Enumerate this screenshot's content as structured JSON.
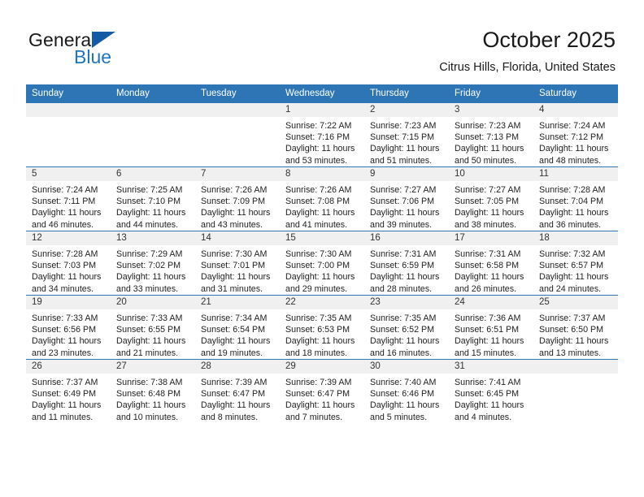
{
  "brand": {
    "name_part1": "General",
    "name_part2": "Blue",
    "accent_color": "#1e74c4",
    "triangle_color": "#1359a5"
  },
  "header": {
    "month_title": "October 2025",
    "location": "Citrus Hills, Florida, United States"
  },
  "calendar": {
    "header_color": "#2e75b6",
    "daynum_band_color": "#f0f0f0",
    "weekdays": [
      "Sunday",
      "Monday",
      "Tuesday",
      "Wednesday",
      "Thursday",
      "Friday",
      "Saturday"
    ],
    "weeks": [
      [
        {
          "day": "",
          "empty": true
        },
        {
          "day": "",
          "empty": true
        },
        {
          "day": "",
          "empty": true
        },
        {
          "day": "1",
          "sunrise": "Sunrise: 7:22 AM",
          "sunset": "Sunset: 7:16 PM",
          "daylight_l1": "Daylight: 11 hours",
          "daylight_l2": "and 53 minutes."
        },
        {
          "day": "2",
          "sunrise": "Sunrise: 7:23 AM",
          "sunset": "Sunset: 7:15 PM",
          "daylight_l1": "Daylight: 11 hours",
          "daylight_l2": "and 51 minutes."
        },
        {
          "day": "3",
          "sunrise": "Sunrise: 7:23 AM",
          "sunset": "Sunset: 7:13 PM",
          "daylight_l1": "Daylight: 11 hours",
          "daylight_l2": "and 50 minutes."
        },
        {
          "day": "4",
          "sunrise": "Sunrise: 7:24 AM",
          "sunset": "Sunset: 7:12 PM",
          "daylight_l1": "Daylight: 11 hours",
          "daylight_l2": "and 48 minutes."
        }
      ],
      [
        {
          "day": "5",
          "sunrise": "Sunrise: 7:24 AM",
          "sunset": "Sunset: 7:11 PM",
          "daylight_l1": "Daylight: 11 hours",
          "daylight_l2": "and 46 minutes."
        },
        {
          "day": "6",
          "sunrise": "Sunrise: 7:25 AM",
          "sunset": "Sunset: 7:10 PM",
          "daylight_l1": "Daylight: 11 hours",
          "daylight_l2": "and 44 minutes."
        },
        {
          "day": "7",
          "sunrise": "Sunrise: 7:26 AM",
          "sunset": "Sunset: 7:09 PM",
          "daylight_l1": "Daylight: 11 hours",
          "daylight_l2": "and 43 minutes."
        },
        {
          "day": "8",
          "sunrise": "Sunrise: 7:26 AM",
          "sunset": "Sunset: 7:08 PM",
          "daylight_l1": "Daylight: 11 hours",
          "daylight_l2": "and 41 minutes."
        },
        {
          "day": "9",
          "sunrise": "Sunrise: 7:27 AM",
          "sunset": "Sunset: 7:06 PM",
          "daylight_l1": "Daylight: 11 hours",
          "daylight_l2": "and 39 minutes."
        },
        {
          "day": "10",
          "sunrise": "Sunrise: 7:27 AM",
          "sunset": "Sunset: 7:05 PM",
          "daylight_l1": "Daylight: 11 hours",
          "daylight_l2": "and 38 minutes."
        },
        {
          "day": "11",
          "sunrise": "Sunrise: 7:28 AM",
          "sunset": "Sunset: 7:04 PM",
          "daylight_l1": "Daylight: 11 hours",
          "daylight_l2": "and 36 minutes."
        }
      ],
      [
        {
          "day": "12",
          "sunrise": "Sunrise: 7:28 AM",
          "sunset": "Sunset: 7:03 PM",
          "daylight_l1": "Daylight: 11 hours",
          "daylight_l2": "and 34 minutes."
        },
        {
          "day": "13",
          "sunrise": "Sunrise: 7:29 AM",
          "sunset": "Sunset: 7:02 PM",
          "daylight_l1": "Daylight: 11 hours",
          "daylight_l2": "and 33 minutes."
        },
        {
          "day": "14",
          "sunrise": "Sunrise: 7:30 AM",
          "sunset": "Sunset: 7:01 PM",
          "daylight_l1": "Daylight: 11 hours",
          "daylight_l2": "and 31 minutes."
        },
        {
          "day": "15",
          "sunrise": "Sunrise: 7:30 AM",
          "sunset": "Sunset: 7:00 PM",
          "daylight_l1": "Daylight: 11 hours",
          "daylight_l2": "and 29 minutes."
        },
        {
          "day": "16",
          "sunrise": "Sunrise: 7:31 AM",
          "sunset": "Sunset: 6:59 PM",
          "daylight_l1": "Daylight: 11 hours",
          "daylight_l2": "and 28 minutes."
        },
        {
          "day": "17",
          "sunrise": "Sunrise: 7:31 AM",
          "sunset": "Sunset: 6:58 PM",
          "daylight_l1": "Daylight: 11 hours",
          "daylight_l2": "and 26 minutes."
        },
        {
          "day": "18",
          "sunrise": "Sunrise: 7:32 AM",
          "sunset": "Sunset: 6:57 PM",
          "daylight_l1": "Daylight: 11 hours",
          "daylight_l2": "and 24 minutes."
        }
      ],
      [
        {
          "day": "19",
          "sunrise": "Sunrise: 7:33 AM",
          "sunset": "Sunset: 6:56 PM",
          "daylight_l1": "Daylight: 11 hours",
          "daylight_l2": "and 23 minutes."
        },
        {
          "day": "20",
          "sunrise": "Sunrise: 7:33 AM",
          "sunset": "Sunset: 6:55 PM",
          "daylight_l1": "Daylight: 11 hours",
          "daylight_l2": "and 21 minutes."
        },
        {
          "day": "21",
          "sunrise": "Sunrise: 7:34 AM",
          "sunset": "Sunset: 6:54 PM",
          "daylight_l1": "Daylight: 11 hours",
          "daylight_l2": "and 19 minutes."
        },
        {
          "day": "22",
          "sunrise": "Sunrise: 7:35 AM",
          "sunset": "Sunset: 6:53 PM",
          "daylight_l1": "Daylight: 11 hours",
          "daylight_l2": "and 18 minutes."
        },
        {
          "day": "23",
          "sunrise": "Sunrise: 7:35 AM",
          "sunset": "Sunset: 6:52 PM",
          "daylight_l1": "Daylight: 11 hours",
          "daylight_l2": "and 16 minutes."
        },
        {
          "day": "24",
          "sunrise": "Sunrise: 7:36 AM",
          "sunset": "Sunset: 6:51 PM",
          "daylight_l1": "Daylight: 11 hours",
          "daylight_l2": "and 15 minutes."
        },
        {
          "day": "25",
          "sunrise": "Sunrise: 7:37 AM",
          "sunset": "Sunset: 6:50 PM",
          "daylight_l1": "Daylight: 11 hours",
          "daylight_l2": "and 13 minutes."
        }
      ],
      [
        {
          "day": "26",
          "sunrise": "Sunrise: 7:37 AM",
          "sunset": "Sunset: 6:49 PM",
          "daylight_l1": "Daylight: 11 hours",
          "daylight_l2": "and 11 minutes."
        },
        {
          "day": "27",
          "sunrise": "Sunrise: 7:38 AM",
          "sunset": "Sunset: 6:48 PM",
          "daylight_l1": "Daylight: 11 hours",
          "daylight_l2": "and 10 minutes."
        },
        {
          "day": "28",
          "sunrise": "Sunrise: 7:39 AM",
          "sunset": "Sunset: 6:47 PM",
          "daylight_l1": "Daylight: 11 hours",
          "daylight_l2": "and 8 minutes."
        },
        {
          "day": "29",
          "sunrise": "Sunrise: 7:39 AM",
          "sunset": "Sunset: 6:47 PM",
          "daylight_l1": "Daylight: 11 hours",
          "daylight_l2": "and 7 minutes."
        },
        {
          "day": "30",
          "sunrise": "Sunrise: 7:40 AM",
          "sunset": "Sunset: 6:46 PM",
          "daylight_l1": "Daylight: 11 hours",
          "daylight_l2": "and 5 minutes."
        },
        {
          "day": "31",
          "sunrise": "Sunrise: 7:41 AM",
          "sunset": "Sunset: 6:45 PM",
          "daylight_l1": "Daylight: 11 hours",
          "daylight_l2": "and 4 minutes."
        },
        {
          "day": "",
          "empty": true
        }
      ]
    ]
  }
}
